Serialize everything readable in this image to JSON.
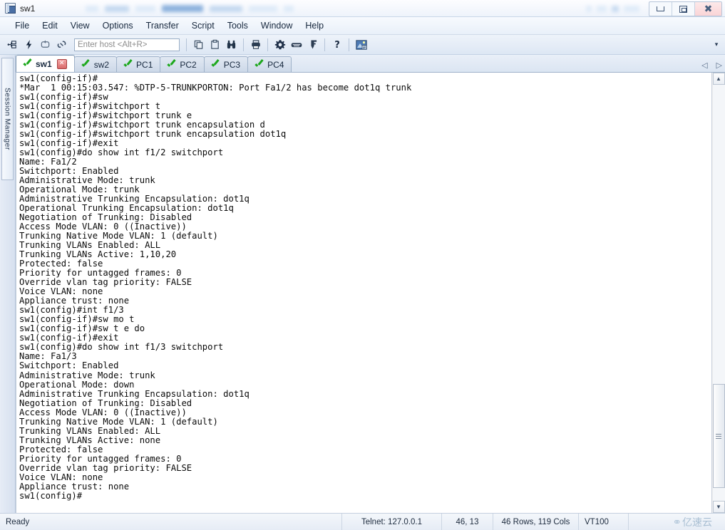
{
  "window": {
    "title": "sw1",
    "app_icon": "terminal-window-icon",
    "controls": {
      "minimize": "minimize",
      "restore": "restore",
      "close": "close"
    }
  },
  "menubar": {
    "items": [
      {
        "label": "File"
      },
      {
        "label": "Edit"
      },
      {
        "label": "View"
      },
      {
        "label": "Options"
      },
      {
        "label": "Transfer"
      },
      {
        "label": "Script"
      },
      {
        "label": "Tools"
      },
      {
        "label": "Window"
      },
      {
        "label": "Help"
      }
    ]
  },
  "toolbar": {
    "buttons": [
      {
        "name": "connect-icon",
        "glyph": "⎇"
      },
      {
        "name": "quick-connect-icon",
        "glyph": "⚡"
      },
      {
        "name": "reconnect-icon",
        "glyph": "↻"
      },
      {
        "name": "disconnect-icon",
        "glyph": "⛓"
      },
      {
        "name": "copy-icon",
        "glyph": "❐"
      },
      {
        "name": "paste-icon",
        "glyph": "Ὄb"
      },
      {
        "name": "find-icon",
        "glyph": "🔭"
      },
      {
        "name": "print-icon",
        "glyph": "⎙"
      },
      {
        "name": "session-options-icon",
        "glyph": "⚙"
      },
      {
        "name": "keymap-editor-icon",
        "glyph": "⌨"
      },
      {
        "name": "key-icon",
        "glyph": "⚿"
      },
      {
        "name": "help-icon",
        "glyph": "?"
      },
      {
        "name": "screen-capture-icon",
        "glyph": "Ὓc"
      }
    ],
    "host_input": {
      "placeholder": "Enter host <Alt+R>",
      "value": ""
    },
    "overflow_label": "▾"
  },
  "sidebar": {
    "session_manager_label": "Session Manager"
  },
  "tabs": {
    "items": [
      {
        "label": "sw1",
        "active": true,
        "status": "connected"
      },
      {
        "label": "sw2",
        "active": false,
        "status": "connected"
      },
      {
        "label": "PC1",
        "active": false,
        "status": "connected"
      },
      {
        "label": "PC2",
        "active": false,
        "status": "connected"
      },
      {
        "label": "PC3",
        "active": false,
        "status": "connected"
      },
      {
        "label": "PC4",
        "active": false,
        "status": "connected"
      }
    ],
    "close_label": "✕",
    "nav_prev": "◁",
    "nav_next": "▷"
  },
  "terminal": {
    "lines": [
      "sw1(config-if)#",
      "*Mar  1 00:15:03.547: %DTP-5-TRUNKPORTON: Port Fa1/2 has become dot1q trunk",
      "sw1(config-if)#sw",
      "sw1(config-if)#switchport t",
      "sw1(config-if)#switchport trunk e",
      "sw1(config-if)#switchport trunk encapsulation d",
      "sw1(config-if)#switchport trunk encapsulation dot1q",
      "sw1(config-if)#exit",
      "sw1(config)#do show int f1/2 switchport",
      "Name: Fa1/2",
      "Switchport: Enabled",
      "Administrative Mode: trunk",
      "Operational Mode: trunk",
      "Administrative Trunking Encapsulation: dot1q",
      "Operational Trunking Encapsulation: dot1q",
      "Negotiation of Trunking: Disabled",
      "Access Mode VLAN: 0 ((Inactive))",
      "Trunking Native Mode VLAN: 1 (default)",
      "Trunking VLANs Enabled: ALL",
      "Trunking VLANs Active: 1,10,20",
      "Protected: false",
      "Priority for untagged frames: 0",
      "Override vlan tag priority: FALSE",
      "Voice VLAN: none",
      "Appliance trust: none",
      "sw1(config)#int f1/3",
      "sw1(config-if)#sw mo t",
      "sw1(config-if)#sw t e do",
      "sw1(config-if)#exit",
      "sw1(config)#do show int f1/3 switchport",
      "Name: Fa1/3",
      "Switchport: Enabled",
      "Administrative Mode: trunk",
      "Operational Mode: down",
      "Administrative Trunking Encapsulation: dot1q",
      "Negotiation of Trunking: Disabled",
      "Access Mode VLAN: 0 ((Inactive))",
      "Trunking Native Mode VLAN: 1 (default)",
      "Trunking VLANs Enabled: ALL",
      "Trunking VLANs Active: none",
      "Protected: false",
      "Priority for untagged frames: 0",
      "Override vlan tag priority: FALSE",
      "Voice VLAN: none",
      "Appliance trust: none",
      "sw1(config)#"
    ]
  },
  "scrollbar": {
    "up_arrow": "▲",
    "down_arrow": "▼",
    "thumb_top_pct": 72,
    "thumb_height_pct": 25
  },
  "statusbar": {
    "status": "Ready",
    "connection": "Telnet: 127.0.0.1",
    "cursor_position": "46, 13",
    "screen_size": "46 Rows, 119 Cols",
    "emulation": "VT100",
    "watermark": "亿速云"
  },
  "colors": {
    "terminal_bg": "#ffffff",
    "terminal_fg": "#0a0a0a",
    "chrome": "#e4ecf6",
    "tab_active": "#ffffff",
    "check_green": "#1ca81c",
    "close_red": "#d96a6a"
  }
}
